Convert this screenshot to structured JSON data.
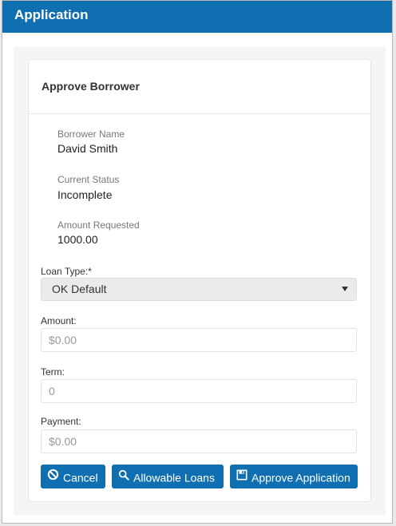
{
  "window": {
    "title": "Application"
  },
  "panel": {
    "title": "Approve Borrower"
  },
  "info": {
    "borrower_name_label": "Borrower Name",
    "borrower_name": "David Smith",
    "status_label": "Current Status",
    "status": "Incomplete",
    "amount_requested_label": "Amount Requested",
    "amount_requested": "1000.00"
  },
  "form": {
    "loan_type_label": "Loan Type:*",
    "loan_type_value": "OK Default",
    "amount_label": "Amount:",
    "amount_placeholder": "$0.00",
    "term_label": "Term:",
    "term_placeholder": "0",
    "payment_label": "Payment:",
    "payment_placeholder": "$0.00"
  },
  "buttons": {
    "cancel": "Cancel",
    "allowable_loans": "Allowable Loans",
    "approve": "Approve Application"
  },
  "icons": {
    "cancel": "ban-icon",
    "allowable_loans": "search-icon",
    "approve": "save-icon"
  },
  "colors": {
    "accent": "#0f6fb1"
  }
}
